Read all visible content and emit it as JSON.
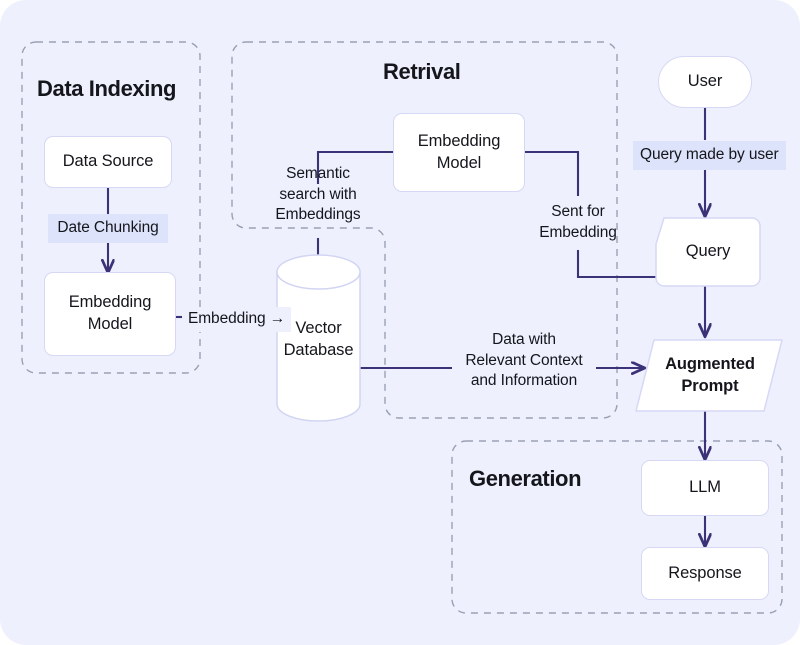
{
  "theme": {
    "canvas_bg": "#eef1fd",
    "node_bg": "#ffffff",
    "node_border": "#d6d8f5",
    "connector": "#3b3277",
    "group_border": "#9aa0b4",
    "highlight_bg": "#dde3fa",
    "text": "#14161c"
  },
  "groups": [
    {
      "name": "data-indexing",
      "title": "Data Indexing"
    },
    {
      "name": "retrieval",
      "title": "Retrival"
    },
    {
      "name": "generation",
      "title": "Generation"
    }
  ],
  "nodes": {
    "data_source": "Data Source",
    "indexing_embedding_model": "Embedding\nModel",
    "retrieval_embedding_model": "Embedding\nModel",
    "vector_database": "Vector\nDatabase",
    "user": "User",
    "query": "Query",
    "augmented_prompt": "Augmented\nPrompt",
    "llm": "LLM",
    "response": "Response"
  },
  "edge_labels": {
    "date_chunking": "Date Chunking",
    "embedding": "Embedding →",
    "semantic_search": "Semantic\nsearch with\nEmbeddings",
    "sent_for_embedding": "Sent for\nEmbedding",
    "query_made_by_user": "Query made by user",
    "data_with_context": "Data with\nRelevant Context\nand Information"
  },
  "chart_data": {
    "type": "diagram",
    "title": "Retrieval-Augmented Generation (RAG) pipeline",
    "subgraphs": [
      {
        "label": "Data Indexing",
        "nodes": [
          "Data Source",
          "Embedding Model"
        ]
      },
      {
        "label": "Retrival",
        "nodes": [
          "Embedding Model",
          "Vector Database"
        ]
      },
      {
        "label": "Generation",
        "nodes": [
          "LLM",
          "Response"
        ]
      }
    ],
    "standalone_nodes": [
      "User",
      "Query",
      "Augmented Prompt"
    ],
    "edges": [
      {
        "from": "Data Source",
        "to": "Embedding Model",
        "label": "Date Chunking",
        "arrow": true
      },
      {
        "from": "Embedding Model",
        "to": "Vector Database",
        "label": "Embedding →",
        "arrow": true
      },
      {
        "from": "Embedding Model",
        "to": "Vector Database",
        "label": "Semantic search with Embeddings",
        "arrow": true
      },
      {
        "from": "Query",
        "to": "Embedding Model",
        "label": "Sent for Embedding",
        "arrow": false
      },
      {
        "from": "User",
        "to": "Query",
        "label": "Query made by user",
        "arrow": true
      },
      {
        "from": "Vector Database",
        "to": "Augmented Prompt",
        "label": "Data with Relevant Context and Information",
        "arrow": true
      },
      {
        "from": "Query",
        "to": "Augmented Prompt",
        "label": "",
        "arrow": true
      },
      {
        "from": "Augmented Prompt",
        "to": "LLM",
        "label": "",
        "arrow": true
      },
      {
        "from": "LLM",
        "to": "Response",
        "label": "",
        "arrow": true
      }
    ]
  }
}
